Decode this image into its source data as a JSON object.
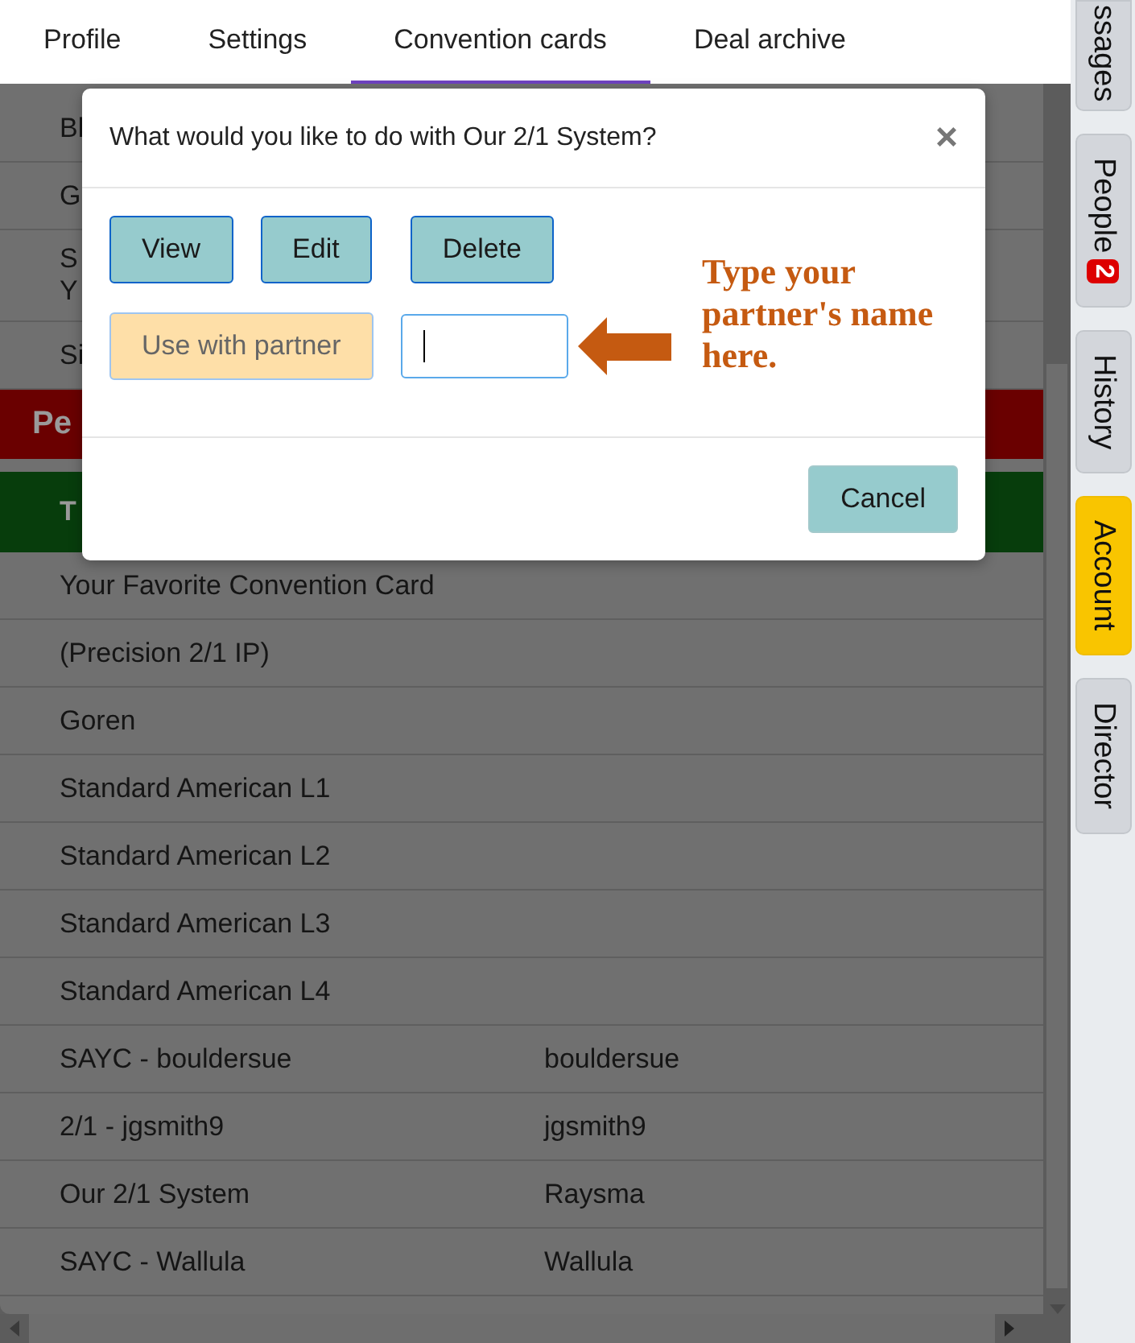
{
  "tabs": [
    {
      "label": "Profile",
      "selected": false
    },
    {
      "label": "Settings",
      "selected": false
    },
    {
      "label": "Convention cards",
      "selected": true
    },
    {
      "label": "Deal archive",
      "selected": false
    }
  ],
  "sidebar": {
    "tabs": [
      {
        "label": "ssages",
        "selected": false
      },
      {
        "label": "People",
        "badge": "2",
        "selected": false
      },
      {
        "label": "History",
        "selected": false
      },
      {
        "label": "Account",
        "selected": true
      },
      {
        "label": "Director",
        "selected": false
      }
    ]
  },
  "table": {
    "partial_rows": [
      {
        "lines": [
          "Bl"
        ]
      },
      {
        "lines": [
          "G"
        ]
      },
      {
        "lines": [
          "S",
          "Y"
        ]
      },
      {
        "lines": [
          "Si"
        ]
      }
    ],
    "section_header": "Pe",
    "column_header": "T",
    "rows": [
      {
        "name": "Your Favorite Convention Card"
      },
      {
        "name": "(Precision 2/1 IP)"
      },
      {
        "name": "Goren"
      },
      {
        "name": "Standard American L1"
      },
      {
        "name": "Standard American L2"
      },
      {
        "name": "Standard American L3"
      },
      {
        "name": "Standard American L4"
      },
      {
        "name": "SAYC - bouldersue",
        "owner": "bouldersue"
      },
      {
        "name": "2/1 - jgsmith9",
        "owner": "jgsmith9"
      },
      {
        "name": "Our 2/1 System",
        "owner": "Raysma"
      },
      {
        "name": "SAYC - Wallula",
        "owner": "Wallula"
      }
    ]
  },
  "dialog": {
    "title": "What would you like to do with Our 2/1 System?",
    "close": "×",
    "actions": [
      {
        "label": "View"
      },
      {
        "label": "Edit"
      },
      {
        "label": "Delete"
      }
    ],
    "partner_button": "Use with partner",
    "hint": "Type your partner's name here.",
    "cancel": "Cancel"
  }
}
